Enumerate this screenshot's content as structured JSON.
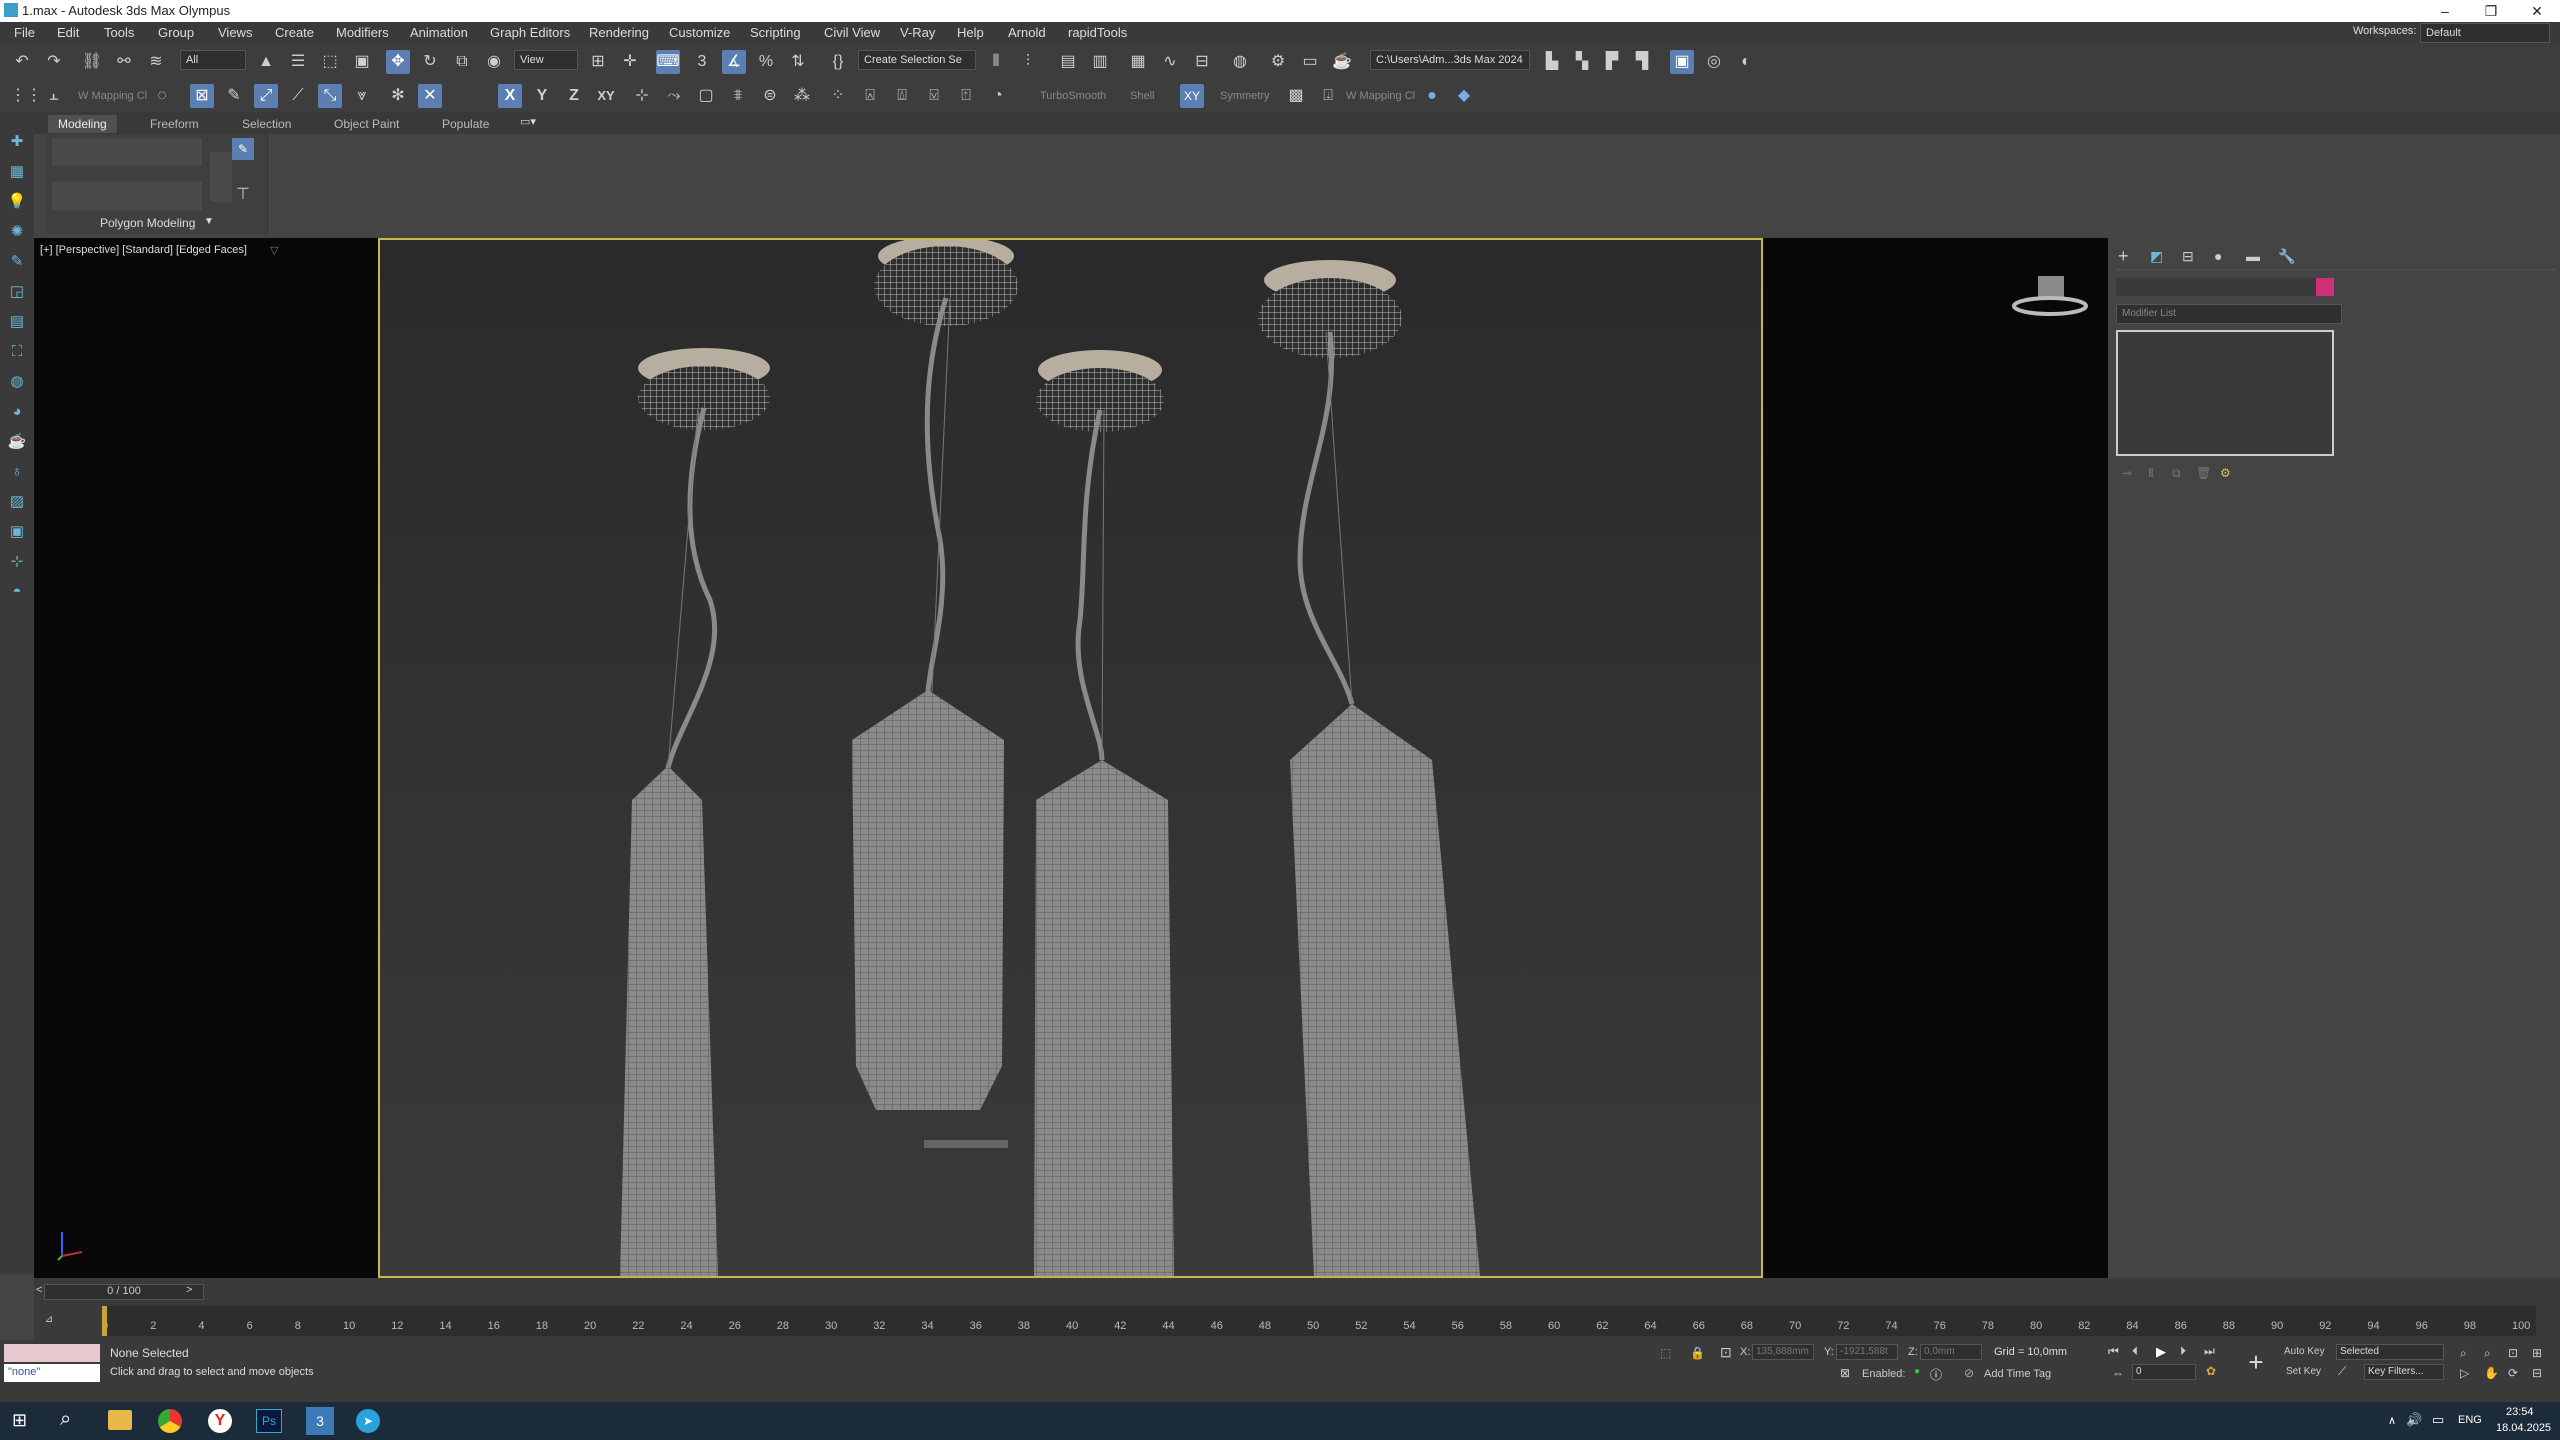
{
  "window": {
    "title": "1.max - Autodesk 3ds Max Olympus",
    "workspaces_label": "Workspaces:",
    "workspace_value": "Default"
  },
  "menu": [
    "File",
    "Edit",
    "Tools",
    "Group",
    "Views",
    "Create",
    "Modifiers",
    "Animation",
    "Graph Editors",
    "Rendering",
    "Customize",
    "Scripting",
    "Civil View",
    "V-Ray",
    "Help",
    "Arnold",
    "rapidTools"
  ],
  "toolbar": {
    "selection_filter": "All",
    "ref_coord": "View",
    "create_selection_set": "Create Selection Se",
    "project_path": "C:\\Users\\Adm...3ds Max 2024",
    "axis_x": "X",
    "axis_y": "Y",
    "axis_z": "Z",
    "axis_xy": "XY",
    "w_mapping": "W Mapping Cl",
    "turbosmooth": "TurboSmooth",
    "shell": "Shell",
    "symmetry": "Symmetry",
    "w_mapping2": "W Mapping Cl"
  },
  "ribbon": {
    "tabs": [
      "Modeling",
      "Freeform",
      "Selection",
      "Object Paint",
      "Populate"
    ],
    "panel_label": "Polygon Modeling"
  },
  "viewport": {
    "label": "[+] [Perspective] [Standard] [Edged Faces]"
  },
  "command_panel": {
    "modifier_list": "Modifier List",
    "accent_color": "#d0307a"
  },
  "timeline": {
    "frame_counter": "0 / 100",
    "ticks": [
      "0",
      "2",
      "4",
      "6",
      "8",
      "10",
      "12",
      "14",
      "16",
      "18",
      "20",
      "22",
      "24",
      "26",
      "28",
      "30",
      "32",
      "34",
      "36",
      "38",
      "40",
      "42",
      "44",
      "46",
      "48",
      "50",
      "52",
      "54",
      "56",
      "58",
      "60",
      "62",
      "64",
      "66",
      "68",
      "70",
      "72",
      "74",
      "76",
      "78",
      "80",
      "82",
      "84",
      "86",
      "88",
      "90",
      "92",
      "94",
      "96",
      "98",
      "100"
    ]
  },
  "status": {
    "script_value": "\"none\"",
    "selection": "None Selected",
    "prompt": "Click and drag to select and move objects",
    "x_label": "X:",
    "x_value": "135,888mm",
    "y_label": "Y:",
    "y_value": "-1921,588t",
    "z_label": "Z:",
    "z_value": "0,0mm",
    "grid": "Grid = 10,0mm",
    "enabled": "Enabled:",
    "add_time_tag": "Add Time Tag",
    "auto_key": "Auto Key",
    "selected": "Selected",
    "set_key": "Set Key",
    "key_filters": "Key Filters...",
    "frame_field": "0"
  },
  "taskbar": {
    "lang": "ENG",
    "time": "23:54",
    "date": "18.04.2025"
  }
}
